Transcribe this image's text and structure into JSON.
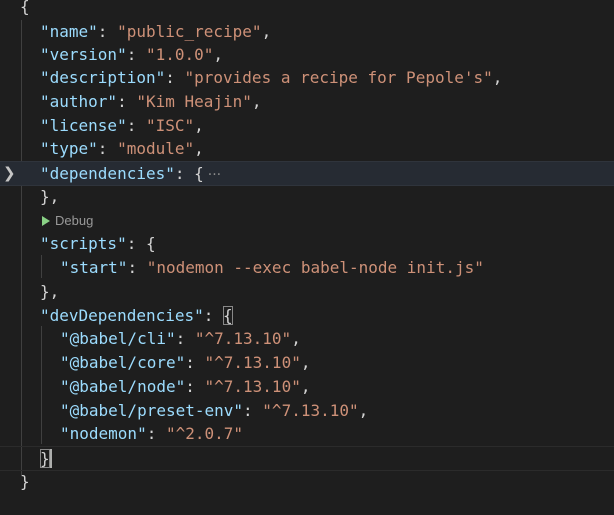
{
  "editor": {
    "lines": {
      "open_brace": "{",
      "name_key": "\"name\"",
      "name_val": "\"public_recipe\"",
      "version_key": "\"version\"",
      "version_val": "\"1.0.0\"",
      "description_key": "\"description\"",
      "description_val": "\"provides a recipe for Pepole's\"",
      "author_key": "\"author\"",
      "author_val": "\"Kim Heajin\"",
      "license_key": "\"license\"",
      "license_val": "\"ISC\"",
      "type_key": "\"type\"",
      "type_val": "\"module\"",
      "dependencies_key": "\"dependencies\"",
      "dependencies_open": "{",
      "folded_ellipsis": "···",
      "dependencies_close": "},",
      "scripts_key": "\"scripts\"",
      "scripts_open": "{",
      "start_key": "\"start\"",
      "start_val": "\"nodemon --exec babel-node init.js\"",
      "scripts_close": "},",
      "devdeps_key": "\"devDependencies\"",
      "devdeps_open": "{",
      "babel_cli_key": "\"@babel/cli\"",
      "babel_cli_val": "\"^7.13.10\"",
      "babel_core_key": "\"@babel/core\"",
      "babel_core_val": "\"^7.13.10\"",
      "babel_node_key": "\"@babel/node\"",
      "babel_node_val": "\"^7.13.10\"",
      "babel_preset_key": "\"@babel/preset-env\"",
      "babel_preset_val": "\"^7.13.10\"",
      "nodemon_key": "\"nodemon\"",
      "nodemon_val": "\"^2.0.7\"",
      "devdeps_close": "}",
      "close_brace": "}"
    },
    "codelens_debug": "Debug",
    "fold_icon": "chevron-right-icon",
    "colors": {
      "background": "#1e1e1e",
      "key": "#9cdcfe",
      "string": "#ce9178",
      "punctuation": "#d4d4d4",
      "codelens_play": "#89d185"
    }
  }
}
